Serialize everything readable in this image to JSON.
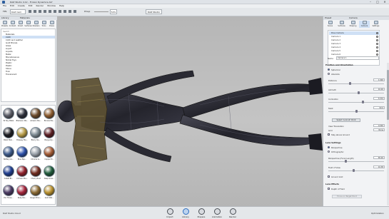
{
  "window": {
    "title": "DAZ Studio 4.12 – Frozen Dynamics.duf",
    "min": "–",
    "max": "□",
    "close": "✕"
  },
  "menubar": [
    "File",
    "Edit",
    "Create",
    "Edit",
    "Render",
    "Window",
    "Help"
  ],
  "toolbar": {
    "fps_label": "FPS",
    "cam_select": "DAZ Cam",
    "preset": "Pinup",
    "zoom": "50%",
    "scene_tab": "DAZ Studio"
  },
  "left_panel": {
    "header": "Library",
    "tab_header": "Materials",
    "tabs": [
      "Presets",
      "Content",
      "Smart",
      "Surfaces",
      "Shaders",
      "Tools",
      "Poses"
    ],
    "search_placeholder": "Search",
    "tree": [
      "Materials",
      "Cloth",
      "Cloth and Leather",
      "Gold Bronze",
      "Glass",
      "Liquid",
      "Liquids",
      "Metal",
      "Miscellaneous",
      "Nickel Toys",
      "Plastic",
      "Plastic",
      "Stone",
      "Toon",
      "Translucent"
    ],
    "selected_index": 1,
    "thumbs": [
      {
        "label": "Pz Sky Metal",
        "color": "#5a5c66"
      },
      {
        "label": "Blackenn Ma...",
        "color": "#2c2f3a"
      },
      {
        "label": "Amazon Ma...",
        "color": "#6b4a2a"
      },
      {
        "label": "Bronze Ma...",
        "color": "#8a5a2d"
      },
      {
        "label": "Black Mat...",
        "color": "#1c1d22"
      },
      {
        "label": "Brassey Ma...",
        "color": "#b59a45"
      },
      {
        "label": "Blurry Va...",
        "color": "#7d8a92"
      },
      {
        "label": "Burgundy...",
        "color": "#5a1d22"
      },
      {
        "label": "Bottery Gl...",
        "color": "#3d5a8a"
      },
      {
        "label": "Blue Pap...",
        "color": "#2b4fa8"
      },
      {
        "label": "Chrome G...",
        "color": "#9aa2aa"
      },
      {
        "label": "Copper M...",
        "color": "#a25a34"
      },
      {
        "label": "Cobalt Bl...",
        "color": "#1f3d8e"
      },
      {
        "label": "Crimson Ma...",
        "color": "#8e1f2a"
      },
      {
        "label": "Cherry Rust",
        "color": "#6e2a1e"
      },
      {
        "label": "Deep Gree...",
        "color": "#1f5a3a"
      },
      {
        "label": "Pro Three...",
        "color": "#4a3a62"
      },
      {
        "label": "Ruby Per...",
        "color": "#a2243a"
      },
      {
        "label": "Ginger Bron...",
        "color": "#8a6a34"
      },
      {
        "label": "Gold Met...",
        "color": "#b8902e"
      }
    ]
  },
  "right_panel": {
    "header_left": "Preset",
    "header_right": "Camera",
    "tabs": [
      "Scene",
      "Surfaces",
      "Shaping",
      "Camera",
      "Settings"
    ],
    "active_tab": 3,
    "cameras": [
      "Pose Camera",
      "Camera 1",
      "Camera 2",
      "Camera 3",
      "Camera 4",
      "Camera 5",
      "Camera 6"
    ],
    "selected_camera": 0,
    "name_label": "Name",
    "name_value": "Camera 1",
    "section_position": "Position and Orientation",
    "radio_spherical": "Spherical",
    "radio_absolute": "Absolute",
    "fields": [
      {
        "label": "Distance",
        "value": "1.000",
        "knob": 0.38
      },
      {
        "label": "Azimuth",
        "value": "10.00",
        "knob": 0.55
      },
      {
        "label": "Inclination",
        "value": "5.570",
        "knob": 0.62
      },
      {
        "label": "Twist",
        "value": "90.0",
        "knob": 0.5
      }
    ],
    "select_look_btn": "Select 'Look at' Point",
    "view_translation": "View Translation",
    "view_translation_value": "0.000",
    "grid_label": "Grid",
    "grid_value": "None",
    "pivot_label": "Stay above Ground",
    "section_lens": "Lens Settings",
    "radio_perspective": "Perspective",
    "radio_ortho": "Orthographic",
    "lens_fields": [
      {
        "label": "Perspective (Focal Length)",
        "value": "65.00",
        "knob": 0.3
      },
      {
        "label": "Field of View",
        "value": "10.38",
        "knob": 0.45
      }
    ],
    "ground_fill": "Ground Grid",
    "section_effects": "Lens Effects",
    "depth_of_field": "Depth of Field",
    "focus_btn": "Focus on Target Point"
  },
  "bottom_bar": {
    "left_label": "DAZ Studio Cloud",
    "items": [
      "Import",
      "Library",
      "Prepare",
      "Animation",
      "Render"
    ],
    "active": 1,
    "right_label": "Optimization"
  }
}
